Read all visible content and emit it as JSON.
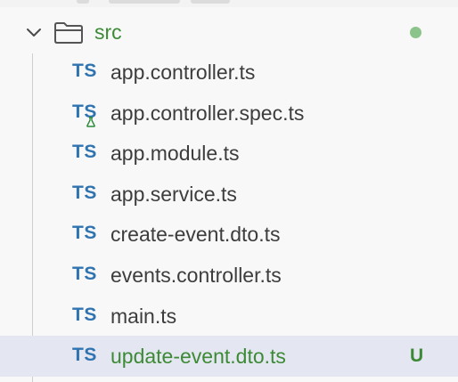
{
  "folder": {
    "name": "src",
    "expanded": true,
    "status_color": "#8bc48a"
  },
  "files": [
    {
      "badge": "TS",
      "name": "app.controller.ts"
    },
    {
      "badge": "TS",
      "name": "app.controller.spec.ts",
      "badge_overlay": "flask-icon"
    },
    {
      "badge": "TS",
      "name": "app.module.ts"
    },
    {
      "badge": "TS",
      "name": "app.service.ts"
    },
    {
      "badge": "TS",
      "name": "create-event.dto.ts"
    },
    {
      "badge": "TS",
      "name": "events.controller.ts"
    },
    {
      "badge": "TS",
      "name": "main.ts"
    },
    {
      "badge": "TS",
      "name": "update-event.dto.ts",
      "status": "U",
      "selected": true
    }
  ],
  "colors": {
    "ts_badge": "#2f73b0",
    "untracked_green": "#3d8a36",
    "selected_row": "#e4e6f1"
  }
}
